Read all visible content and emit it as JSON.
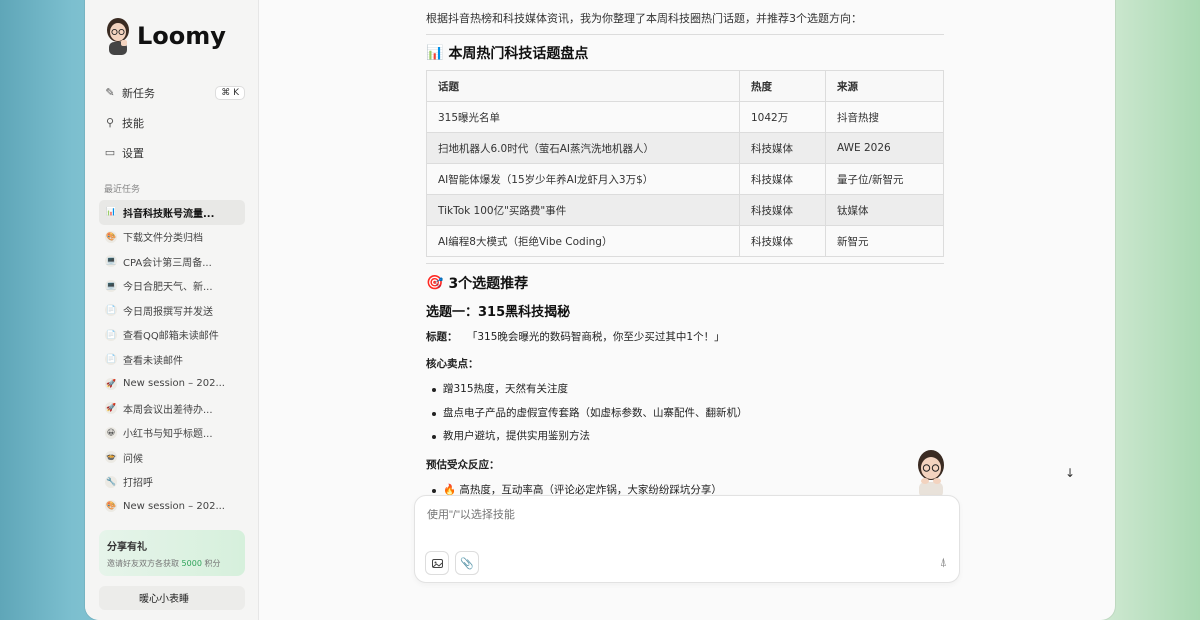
{
  "app": {
    "name": "Loomy"
  },
  "nav": [
    {
      "label": "新任务",
      "icon": "edit-icon",
      "shortcut": "⌘ K"
    },
    {
      "label": "技能",
      "icon": "skills-icon"
    },
    {
      "label": "设置",
      "icon": "folder-settings-icon"
    }
  ],
  "recent": {
    "title": "最近任务",
    "items": [
      {
        "label": "抖音科技账号流量...",
        "icon": "📊"
      },
      {
        "label": "下载文件分类归档",
        "icon": "🎨"
      },
      {
        "label": "CPA会计第三周备...",
        "icon": "💻"
      },
      {
        "label": "今日合肥天气、新...",
        "icon": "💻"
      },
      {
        "label": "今日周报撰写并发送",
        "icon": "📄"
      },
      {
        "label": "查看QQ邮箱未读邮件",
        "icon": "📄"
      },
      {
        "label": "查看未读邮件",
        "icon": "📄"
      },
      {
        "label": "New session – 202...",
        "icon": "🚀"
      },
      {
        "label": "本周会议出差待办...",
        "icon": "🚀"
      },
      {
        "label": "小红书与知乎标题...",
        "icon": "😀"
      },
      {
        "label": "问候",
        "icon": "🍲"
      },
      {
        "label": "打招呼",
        "icon": "🔧"
      },
      {
        "label": "New session – 202...",
        "icon": "🎨"
      }
    ]
  },
  "share": {
    "title": "分享有礼",
    "desc_prefix": "邀请好友双方各获取",
    "points": "5000",
    "desc_suffix": "积分"
  },
  "user": {
    "name": "暖心小表睡"
  },
  "content": {
    "intro": "根据抖音热榜和科技媒体资讯，我为你整理了本周科技圈热门话题，并推荐3个选题方向：",
    "section1": {
      "emoji": "📊",
      "title": "本周热门科技话题盘点"
    },
    "table": {
      "headers": [
        "话题",
        "热度",
        "来源"
      ],
      "rows": [
        [
          "315曝光名单",
          "1042万",
          "抖音热搜"
        ],
        [
          "扫地机器人6.0时代（萤石AI蒸汽洗地机器人）",
          "科技媒体",
          "AWE 2026"
        ],
        [
          "AI智能体爆发（15岁少年养AI龙虾月入3万$）",
          "科技媒体",
          "量子位/新智元"
        ],
        [
          "TikTok 100亿\"买路费\"事件",
          "科技媒体",
          "钛媒体"
        ],
        [
          "AI编程8大模式（拒绝Vibe Coding）",
          "科技媒体",
          "新智元"
        ]
      ]
    },
    "section2": {
      "emoji": "🎯",
      "title": "3个选题推荐"
    },
    "topic1": {
      "heading": "选题一：315黑科技揭秘",
      "title_label": "标题：",
      "title_value": "「315晚会曝光的数码智商税，你至少买过其中1个！」",
      "selling_label": "核心卖点：",
      "selling_points": [
        "蹭315热度，天然有关注度",
        "盘点电子产品的虚假宣传套路（如虚标参数、山寨配件、翻新机）",
        "教用户避坑，提供实用鉴别方法"
      ],
      "reaction_label": "预估受众反应：",
      "reaction_first": "🔥 高热度，互动率高（评论必定炸锅，大家纷纷踩坑分享）"
    }
  },
  "composer": {
    "placeholder": "使用\"/\"以选择技能"
  },
  "colors": {
    "accent_green": "#2fa35a",
    "window_bg": "#fafafa",
    "sidebar_bg": "#f5f5f4"
  }
}
